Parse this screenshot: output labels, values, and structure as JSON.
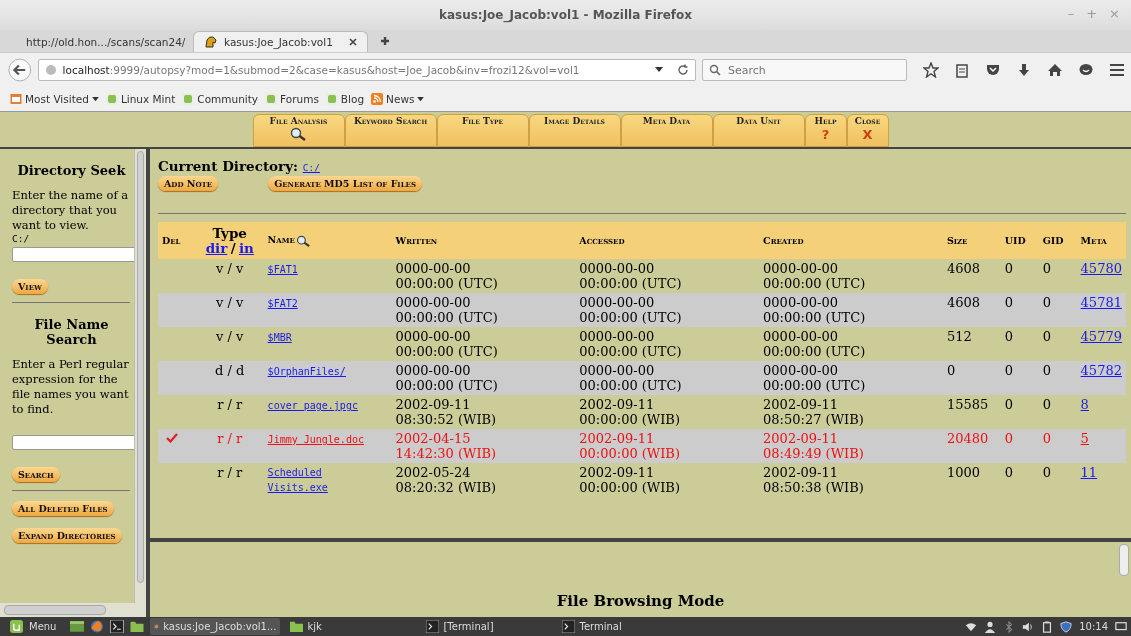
{
  "window": {
    "title": "kasus:Joe_Jacob:vol1 - Mozilla Firefox",
    "controls": [
      "–",
      "+",
      "×"
    ]
  },
  "tabs": [
    {
      "label": "http://old.hon.../scans/scan24/",
      "selected": false
    },
    {
      "label": "kasus:Joe_Jacob:vol1",
      "selected": true
    }
  ],
  "address": {
    "host": "localhost",
    "rest": ":9999/autopsy?mod=1&submod=2&case=kasus&host=Joe_Jacob&inv=frozi12&vol=vol1"
  },
  "search": {
    "placeholder": "Search"
  },
  "bookmarks": [
    {
      "label": "Most Visited",
      "kind": "folder",
      "menu": true
    },
    {
      "label": "Linux Mint",
      "kind": "mint",
      "menu": false
    },
    {
      "label": "Community",
      "kind": "mint",
      "menu": false
    },
    {
      "label": "Forums",
      "kind": "mint",
      "menu": false
    },
    {
      "label": "Blog",
      "kind": "mint",
      "menu": false
    },
    {
      "label": "News",
      "kind": "rss",
      "menu": true
    }
  ],
  "toolbar": [
    {
      "label": "File Analysis",
      "kind": "search"
    },
    {
      "label": "Keyword Search",
      "kind": "plain"
    },
    {
      "label": "File Type",
      "kind": "plain"
    },
    {
      "label": "Image Details",
      "kind": "plain"
    },
    {
      "label": "Meta Data",
      "kind": "plain"
    },
    {
      "label": "Data Unit",
      "kind": "plain"
    },
    {
      "label": "Help",
      "kind": "text",
      "sub": "?"
    },
    {
      "label": "Close",
      "kind": "text",
      "sub": "X"
    }
  ],
  "sidebar": {
    "seek_title": "Directory Seek",
    "seek_text": "Enter the name of a directory that you want to view.",
    "seek_value_hint": "C:/",
    "view_button": "View",
    "search_title": "File Name Search",
    "search_text": "Enter a Perl regular expression for the file names you want to find.",
    "search_button": "Search",
    "buttons": [
      "All Deleted Files",
      "Expand Directories"
    ]
  },
  "current_directory": {
    "label": "Current Directory:",
    "path": "C:/"
  },
  "actions": [
    "Add Note",
    "Generate MD5 List of Files"
  ],
  "table": {
    "columns": {
      "del": "Del",
      "type": "Type",
      "type_dir": "dir",
      "type_sep": "/",
      "type_in": "in",
      "name": "Name",
      "written": "Written",
      "accessed": "Accessed",
      "created": "Created",
      "size": "Size",
      "uid": "UID",
      "gid": "GID",
      "meta": "Meta"
    },
    "rows": [
      {
        "deleted": false,
        "type": "v / v",
        "name": "$FAT1",
        "written": [
          "0000-00-00",
          "00:00:00 (UTC)"
        ],
        "accessed": [
          "0000-00-00",
          "00:00:00 (UTC)"
        ],
        "created": [
          "0000-00-00",
          "00:00:00 (UTC)"
        ],
        "size": "4608",
        "uid": "0",
        "gid": "0",
        "meta": "45780"
      },
      {
        "deleted": false,
        "type": "v / v",
        "name": "$FAT2",
        "written": [
          "0000-00-00",
          "00:00:00 (UTC)"
        ],
        "accessed": [
          "0000-00-00",
          "00:00:00 (UTC)"
        ],
        "created": [
          "0000-00-00",
          "00:00:00 (UTC)"
        ],
        "size": "4608",
        "uid": "0",
        "gid": "0",
        "meta": "45781"
      },
      {
        "deleted": false,
        "type": "v / v",
        "name": "$MBR",
        "written": [
          "0000-00-00",
          "00:00:00 (UTC)"
        ],
        "accessed": [
          "0000-00-00",
          "00:00:00 (UTC)"
        ],
        "created": [
          "0000-00-00",
          "00:00:00 (UTC)"
        ],
        "size": "512",
        "uid": "0",
        "gid": "0",
        "meta": "45779"
      },
      {
        "deleted": false,
        "type": "d / d",
        "name": "$OrphanFiles/",
        "written": [
          "0000-00-00",
          "00:00:00 (UTC)"
        ],
        "accessed": [
          "0000-00-00",
          "00:00:00 (UTC)"
        ],
        "created": [
          "0000-00-00",
          "00:00:00 (UTC)"
        ],
        "size": "0",
        "uid": "0",
        "gid": "0",
        "meta": "45782"
      },
      {
        "deleted": false,
        "type": "r / r",
        "name": "cover page.jpgc",
        "written": [
          "2002-09-11",
          "08:30:52 (WIB)"
        ],
        "accessed": [
          "2002-09-11",
          "00:00:00 (WIB)"
        ],
        "created": [
          "2002-09-11",
          "08:50:27 (WIB)"
        ],
        "size": "15585",
        "uid": "0",
        "gid": "0",
        "meta": "8"
      },
      {
        "deleted": true,
        "type": "r / r",
        "name": "Jimmy Jungle.doc",
        "written": [
          "2002-04-15",
          "14:42:30 (WIB)"
        ],
        "accessed": [
          "2002-09-11",
          "00:00:00 (WIB)"
        ],
        "created": [
          "2002-09-11",
          "08:49:49 (WIB)"
        ],
        "size": "20480",
        "uid": "0",
        "gid": "0",
        "meta": "5"
      },
      {
        "deleted": false,
        "type": "r / r",
        "name": "Scheduled Visits.exe",
        "written": [
          "2002-05-24",
          "08:20:32 (WIB)"
        ],
        "accessed": [
          "2002-09-11",
          "00:00:00 (WIB)"
        ],
        "created": [
          "2002-09-11",
          "08:50:38 (WIB)"
        ],
        "size": "1000",
        "uid": "0",
        "gid": "0",
        "meta": "11"
      }
    ]
  },
  "mode_title": "File Browsing Mode",
  "taskbar": {
    "menu": "Menu",
    "windows": [
      {
        "label": "kasus:Joe_Jacob:vol1...",
        "kind": "firefox",
        "selected": true
      },
      {
        "label": "kjk",
        "kind": "folder",
        "selected": false
      },
      {
        "label": "[Terminal]",
        "kind": "terminal",
        "selected": false
      },
      {
        "label": "Terminal",
        "kind": "terminal",
        "selected": false
      }
    ],
    "clock": "10:14"
  }
}
